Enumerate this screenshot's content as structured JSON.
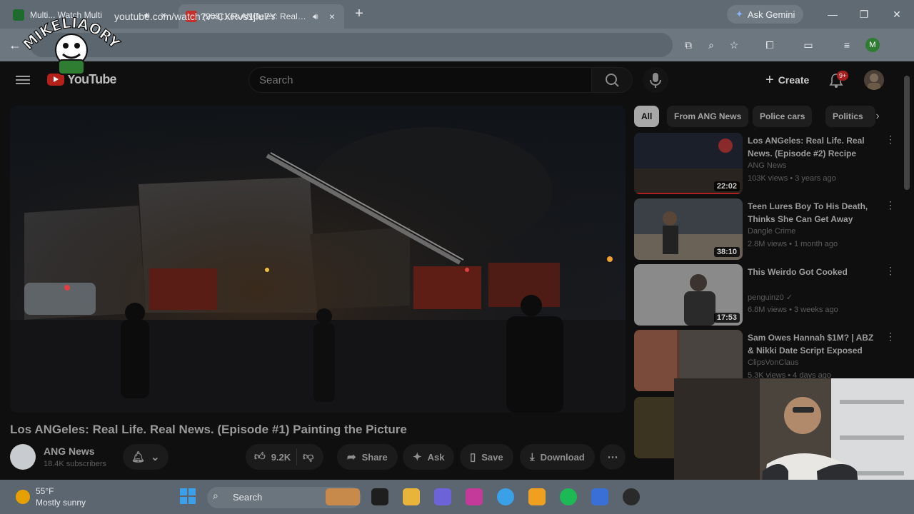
{
  "browser": {
    "tabs": [
      {
        "title": "Multi... Watch Multi",
        "active": false,
        "favicon_color": "#1f6b2e"
      },
      {
        "title": "(208) Los ANGeles: Real Life.",
        "active": true,
        "favicon_color": "#c4302b"
      }
    ],
    "ask_gemini": "Ask Gemini",
    "url": "youtube.com/watch?v=CXRvs1jfu7Y",
    "profile_initial": "M"
  },
  "logo_overlay": {
    "text": "MIKELIAORY"
  },
  "youtube": {
    "search_placeholder": "Search",
    "logo_text": "YouTube",
    "create_label": "Create",
    "notification_badge": "9+",
    "video": {
      "title": "Los ANGeles: Real Life. Real News. (Episode #1) Painting the Picture",
      "channel": "ANG News",
      "subscribers": "18.4K subscribers",
      "likes": "9.2K",
      "share_label": "Share",
      "ask_label": "Ask",
      "save_label": "Save",
      "download_label": "Download"
    },
    "chips": [
      "All",
      "From ANG News",
      "Police cars",
      "Politics"
    ],
    "recommendations": [
      {
        "title": "Los ANGeles: Real Life. Real News. (Episode #2) Recipe for…",
        "channel": "ANG News",
        "meta": "103K views • 3 years ago",
        "duration": "22:02"
      },
      {
        "title": "Teen Lures Boy To His Death, Thinks She Can Get Away With…",
        "channel": "Dangle Crime",
        "meta": "2.8M views • 1 month ago",
        "duration": "38:10"
      },
      {
        "title": "This Weirdo Got Cooked",
        "channel": "penguinz0 ✓",
        "meta": "6.8M views • 3 weeks ago",
        "duration": "17:53"
      },
      {
        "title": "Sam Owes Hannah $1M? | ABZ & Nikki Date Script Exposed",
        "channel": "ClipsVonClaus",
        "meta": "5.3K views • 4 days ago",
        "duration": ""
      }
    ]
  },
  "taskbar": {
    "weather_temp": "55°F",
    "weather_desc": "Mostly sunny",
    "search_label": "Search"
  }
}
